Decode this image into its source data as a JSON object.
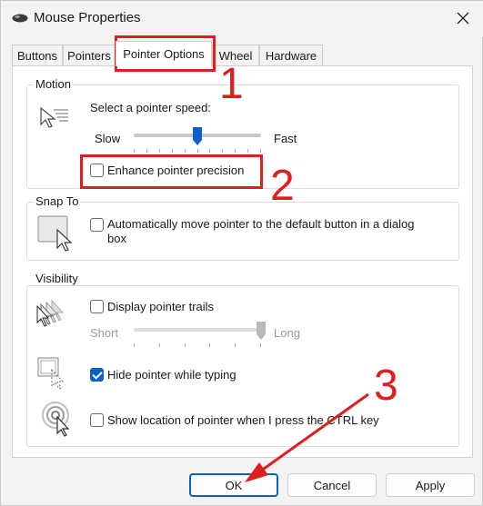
{
  "window": {
    "title": "Mouse Properties"
  },
  "tabs": [
    {
      "label": "Buttons"
    },
    {
      "label": "Pointers"
    },
    {
      "label": "Pointer Options"
    },
    {
      "label": "Wheel"
    },
    {
      "label": "Hardware"
    }
  ],
  "active_tab": "Pointer Options",
  "motion": {
    "group_label": "Motion",
    "speed_label": "Select a pointer speed:",
    "slow_label": "Slow",
    "fast_label": "Fast",
    "speed_value": 0.5,
    "enhance_precision_label": "Enhance pointer precision",
    "enhance_precision_checked": false
  },
  "snap_to": {
    "group_label": "Snap To",
    "auto_move_label_line1": "Automatically move pointer to the default button in a dialog",
    "auto_move_label_line2": "box",
    "auto_move_checked": false
  },
  "visibility": {
    "group_label": "Visibility",
    "trails_label": "Display pointer trails",
    "trails_checked": false,
    "short_label": "Short",
    "long_label": "Long",
    "trail_length_value": 1.0,
    "hide_typing_label": "Hide pointer while typing",
    "hide_typing_checked": true,
    "show_location_label": "Show location of pointer when I press the CTRL key",
    "show_location_checked": false
  },
  "buttons": {
    "ok_label": "OK",
    "cancel_label": "Cancel",
    "apply_label": "Apply"
  },
  "annotations": {
    "step1": "1",
    "step2": "2",
    "step3": "3",
    "color": "#e01e1e"
  },
  "colors": {
    "accent": "#0a62c9"
  }
}
